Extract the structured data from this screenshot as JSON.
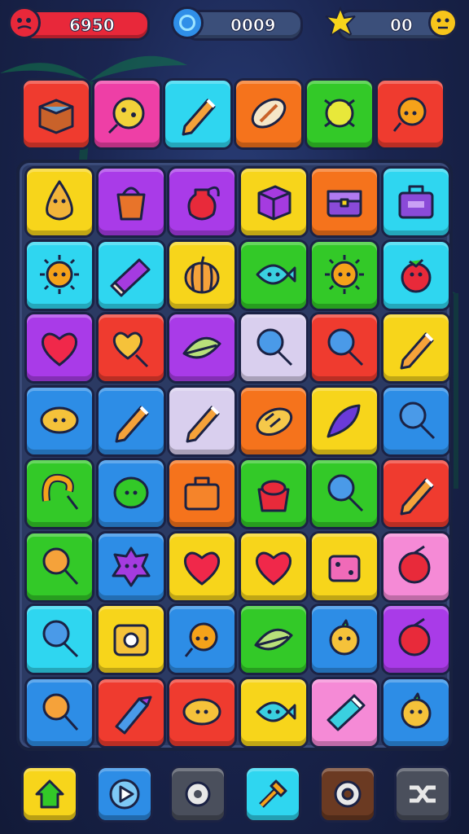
{
  "hud": {
    "score": "6950",
    "coins": "0009",
    "stars": "00"
  },
  "colors": {
    "red": "#ef3b2f",
    "pink": "#ee3fa6",
    "cyan": "#2fd6f0",
    "orange": "#f5731c",
    "green": "#33c928",
    "yellow": "#f7d51b",
    "purple": "#a93be8",
    "blue": "#2d8de6",
    "lavender": "#d9cfee",
    "lightpink": "#f58ad6"
  },
  "top_row": [
    {
      "color": "red",
      "icon": "box-icon"
    },
    {
      "color": "pink",
      "icon": "cookie-icon"
    },
    {
      "color": "cyan",
      "icon": "pencil-icon"
    },
    {
      "color": "orange",
      "icon": "football-icon"
    },
    {
      "color": "green",
      "icon": "bug-icon"
    },
    {
      "color": "red",
      "icon": "bird-icon"
    }
  ],
  "board": [
    [
      {
        "color": "yellow",
        "icon": "drop-icon"
      },
      {
        "color": "purple",
        "icon": "basket-icon"
      },
      {
        "color": "purple",
        "icon": "potion-icon"
      },
      {
        "color": "yellow",
        "icon": "cube-icon"
      },
      {
        "color": "orange",
        "icon": "chest-icon"
      },
      {
        "color": "cyan",
        "icon": "case-icon"
      }
    ],
    [
      {
        "color": "cyan",
        "icon": "sun-icon"
      },
      {
        "color": "cyan",
        "icon": "book-icon"
      },
      {
        "color": "yellow",
        "icon": "pumpkin-icon"
      },
      {
        "color": "green",
        "icon": "fish-icon"
      },
      {
        "color": "green",
        "icon": "sun-icon"
      },
      {
        "color": "cyan",
        "icon": "berry-icon"
      }
    ],
    [
      {
        "color": "purple",
        "icon": "heart-icon"
      },
      {
        "color": "red",
        "icon": "heart-lollipop-icon"
      },
      {
        "color": "purple",
        "icon": "leaf-icon"
      },
      {
        "color": "lavender",
        "icon": "lollipop-icon"
      },
      {
        "color": "red",
        "icon": "lollipop-icon"
      },
      {
        "color": "yellow",
        "icon": "pencil-icon"
      }
    ],
    [
      {
        "color": "blue",
        "icon": "lemon-icon"
      },
      {
        "color": "blue",
        "icon": "pencil-icon"
      },
      {
        "color": "lavender",
        "icon": "pencil-icon"
      },
      {
        "color": "orange",
        "icon": "bread-icon"
      },
      {
        "color": "yellow",
        "icon": "feather-icon"
      },
      {
        "color": "blue",
        "icon": "lollipop-icon"
      }
    ],
    [
      {
        "color": "green",
        "icon": "cane-icon"
      },
      {
        "color": "blue",
        "icon": "blob-icon"
      },
      {
        "color": "orange",
        "icon": "suitcase-icon"
      },
      {
        "color": "green",
        "icon": "pot-icon"
      },
      {
        "color": "green",
        "icon": "lollipop-icon"
      },
      {
        "color": "red",
        "icon": "pencil-icon"
      }
    ],
    [
      {
        "color": "green",
        "icon": "magnifier-icon"
      },
      {
        "color": "blue",
        "icon": "star-blob-icon"
      },
      {
        "color": "yellow",
        "icon": "heart-icon"
      },
      {
        "color": "yellow",
        "icon": "heart-icon"
      },
      {
        "color": "yellow",
        "icon": "dice-icon"
      },
      {
        "color": "lightpink",
        "icon": "cherry-icon"
      }
    ],
    [
      {
        "color": "cyan",
        "icon": "lollipop-icon"
      },
      {
        "color": "yellow",
        "icon": "safe-icon"
      },
      {
        "color": "blue",
        "icon": "bird-icon"
      },
      {
        "color": "green",
        "icon": "leaf-icon"
      },
      {
        "color": "blue",
        "icon": "chick-icon"
      },
      {
        "color": "purple",
        "icon": "cherry-icon"
      }
    ],
    [
      {
        "color": "blue",
        "icon": "magnifier-icon"
      },
      {
        "color": "red",
        "icon": "crayon-icon"
      },
      {
        "color": "red",
        "icon": "lemon-icon"
      },
      {
        "color": "yellow",
        "icon": "fish-icon"
      },
      {
        "color": "lightpink",
        "icon": "battery-icon"
      },
      {
        "color": "blue",
        "icon": "chick-icon"
      }
    ]
  ],
  "bottom_bar": [
    {
      "color": "yellow",
      "icon": "home-icon"
    },
    {
      "color": "blue",
      "icon": "play-icon"
    },
    {
      "color": "grey",
      "icon": "gear-icon"
    },
    {
      "color": "cyan",
      "icon": "hammer-icon"
    },
    {
      "color": "brown",
      "icon": "settings-icon"
    },
    {
      "color": "grey",
      "icon": "shuffle-icon"
    }
  ]
}
